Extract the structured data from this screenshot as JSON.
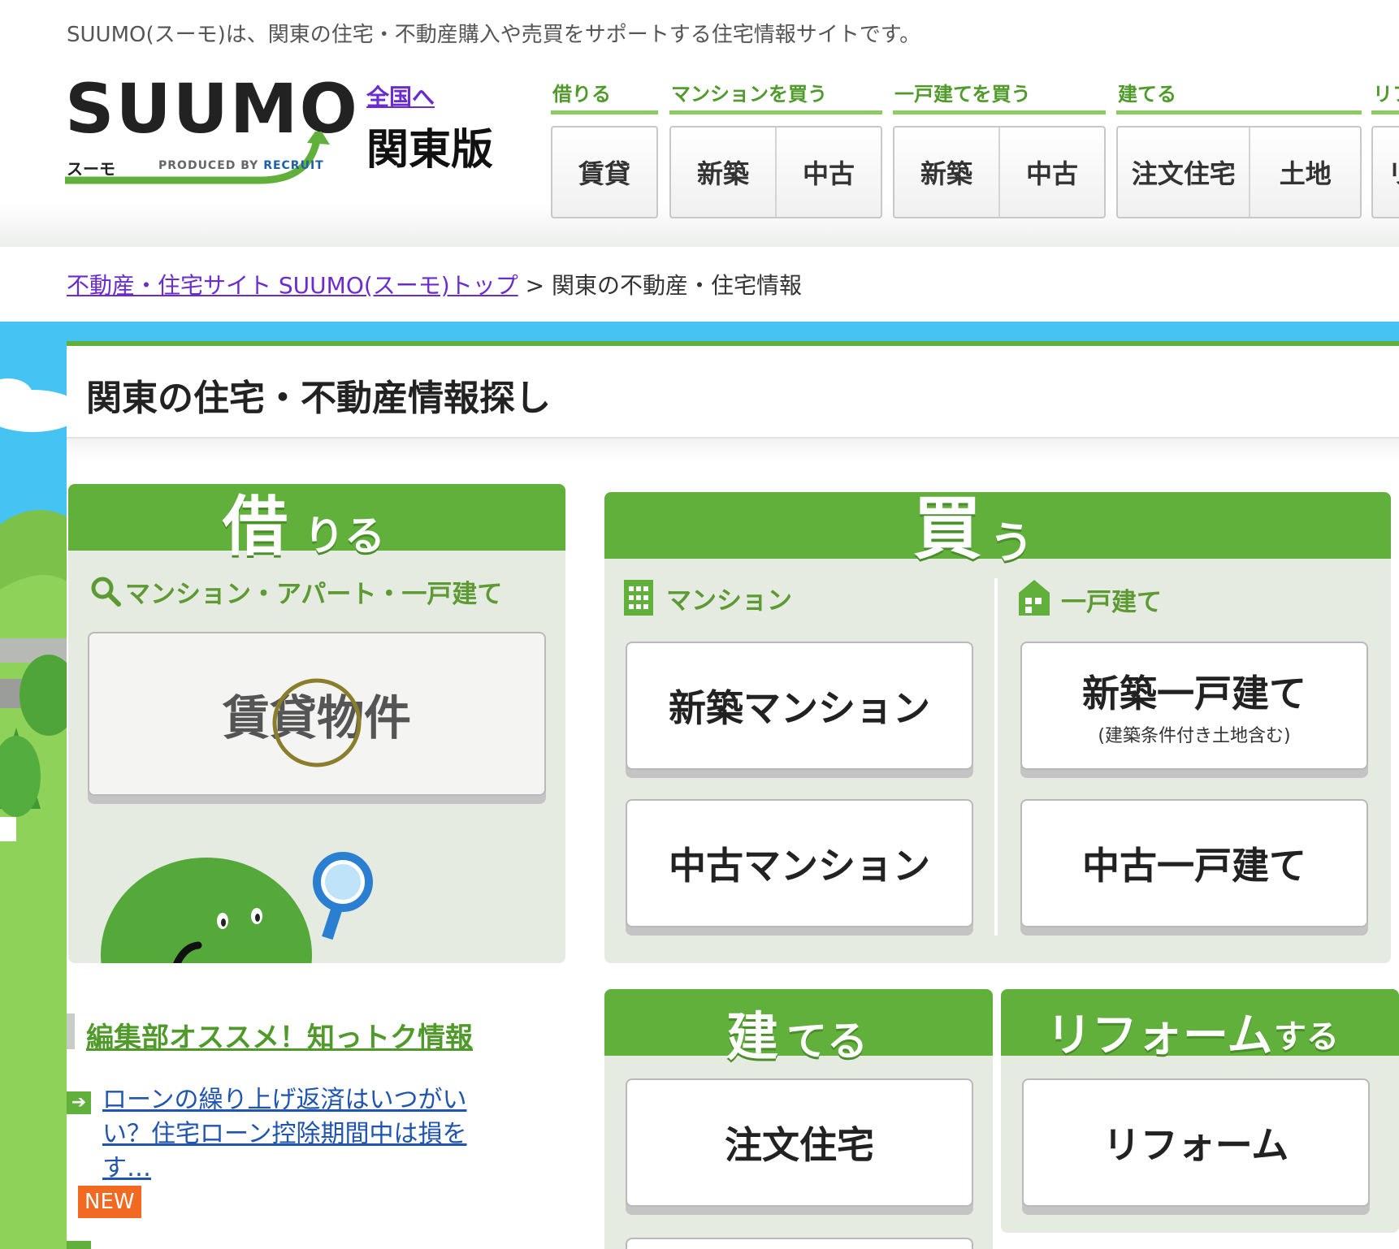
{
  "header": {
    "tagline": "SUUMO(スーモ)は、関東の住宅・不動産購入や売買をサポートする住宅情報サイトです。",
    "logo": {
      "word": "SUUMO",
      "kana": "スーモ",
      "produced": "PRODUCED BY",
      "brand": "RECRUIT"
    },
    "nation_link": "全国へ",
    "region_label": "関東版",
    "nav": [
      {
        "title": "借りる",
        "buttons": [
          "賃貸"
        ]
      },
      {
        "title": "マンションを買う",
        "buttons": [
          "新築",
          "中古"
        ]
      },
      {
        "title": "一戸建てを買う",
        "buttons": [
          "新築",
          "中古"
        ]
      },
      {
        "title": "建てる",
        "buttons": [
          "注文住宅",
          "土地"
        ]
      },
      {
        "title": "リフ",
        "buttons": [
          "リ"
        ]
      }
    ]
  },
  "breadcrumb": {
    "home": "不動産・住宅サイト SUUMO(スーモ)トップ",
    "separator": ">",
    "current": "関東の不動産・住宅情報"
  },
  "main": {
    "title": "関東の住宅・不動産情報探し",
    "rent": {
      "heading_big": "借",
      "heading_small": "りる",
      "section_label": "マンション・アパート・一戸建て",
      "button": "賃貸物件"
    },
    "buy": {
      "heading_big": "買",
      "heading_small": "う",
      "mansion_label": "マンション",
      "house_label": "一戸建て",
      "buttons": {
        "new_mansion": "新築マンション",
        "used_mansion": "中古マンション",
        "new_house": "新築一戸建て",
        "new_house_sub": "(建築条件付き土地含む)",
        "used_house": "中古一戸建て"
      }
    },
    "build": {
      "heading_big": "建",
      "heading_small": "てる",
      "button": "注文住宅"
    },
    "reform": {
      "heading_big": "リフォーム",
      "heading_small": "する",
      "button": "リフォーム"
    }
  },
  "recommend": {
    "heading": "編集部オススメ！知っトク情報",
    "items": [
      {
        "text": "ローンの繰り上げ返済はいつがいい？住宅ローン控除期間中は損をす…",
        "badge": "NEW"
      }
    ]
  },
  "colors": {
    "brand_green": "#62b03c",
    "sky_blue": "#45c3f3",
    "panel_bg": "#e6ebe2",
    "link_purple": "#6a2cd1",
    "new_badge": "#f26a22"
  }
}
